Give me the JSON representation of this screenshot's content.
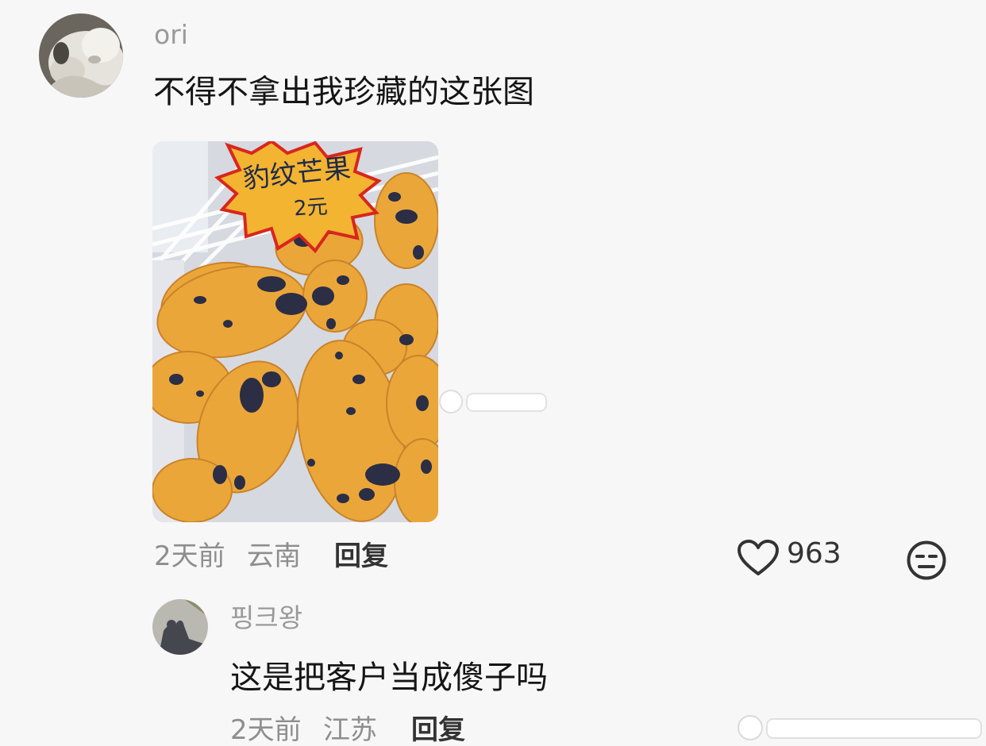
{
  "comments": [
    {
      "username": "ori",
      "text": "不得不拿出我珍藏的这张图",
      "image": {
        "sign_text": "豹纹芒果",
        "price_text": "2元"
      },
      "time": "2天前",
      "location": "云南",
      "reply_label": "回复",
      "likes": "963",
      "like_icon": "heart-outline-icon",
      "dislike_icon": "expressionless-face-icon"
    },
    {
      "username": "핑크왕",
      "text": "这是把客户当成傻子吗",
      "time": "2天前",
      "location": "江苏",
      "reply_label": "回复"
    }
  ],
  "colors": {
    "background": "#f7f7f7",
    "username": "#9a9a9a",
    "meta": "#8e8e8e",
    "text": "#151515",
    "mango": "#e9a73c",
    "sign": "#f3b431",
    "sign_border": "#d8261e"
  }
}
